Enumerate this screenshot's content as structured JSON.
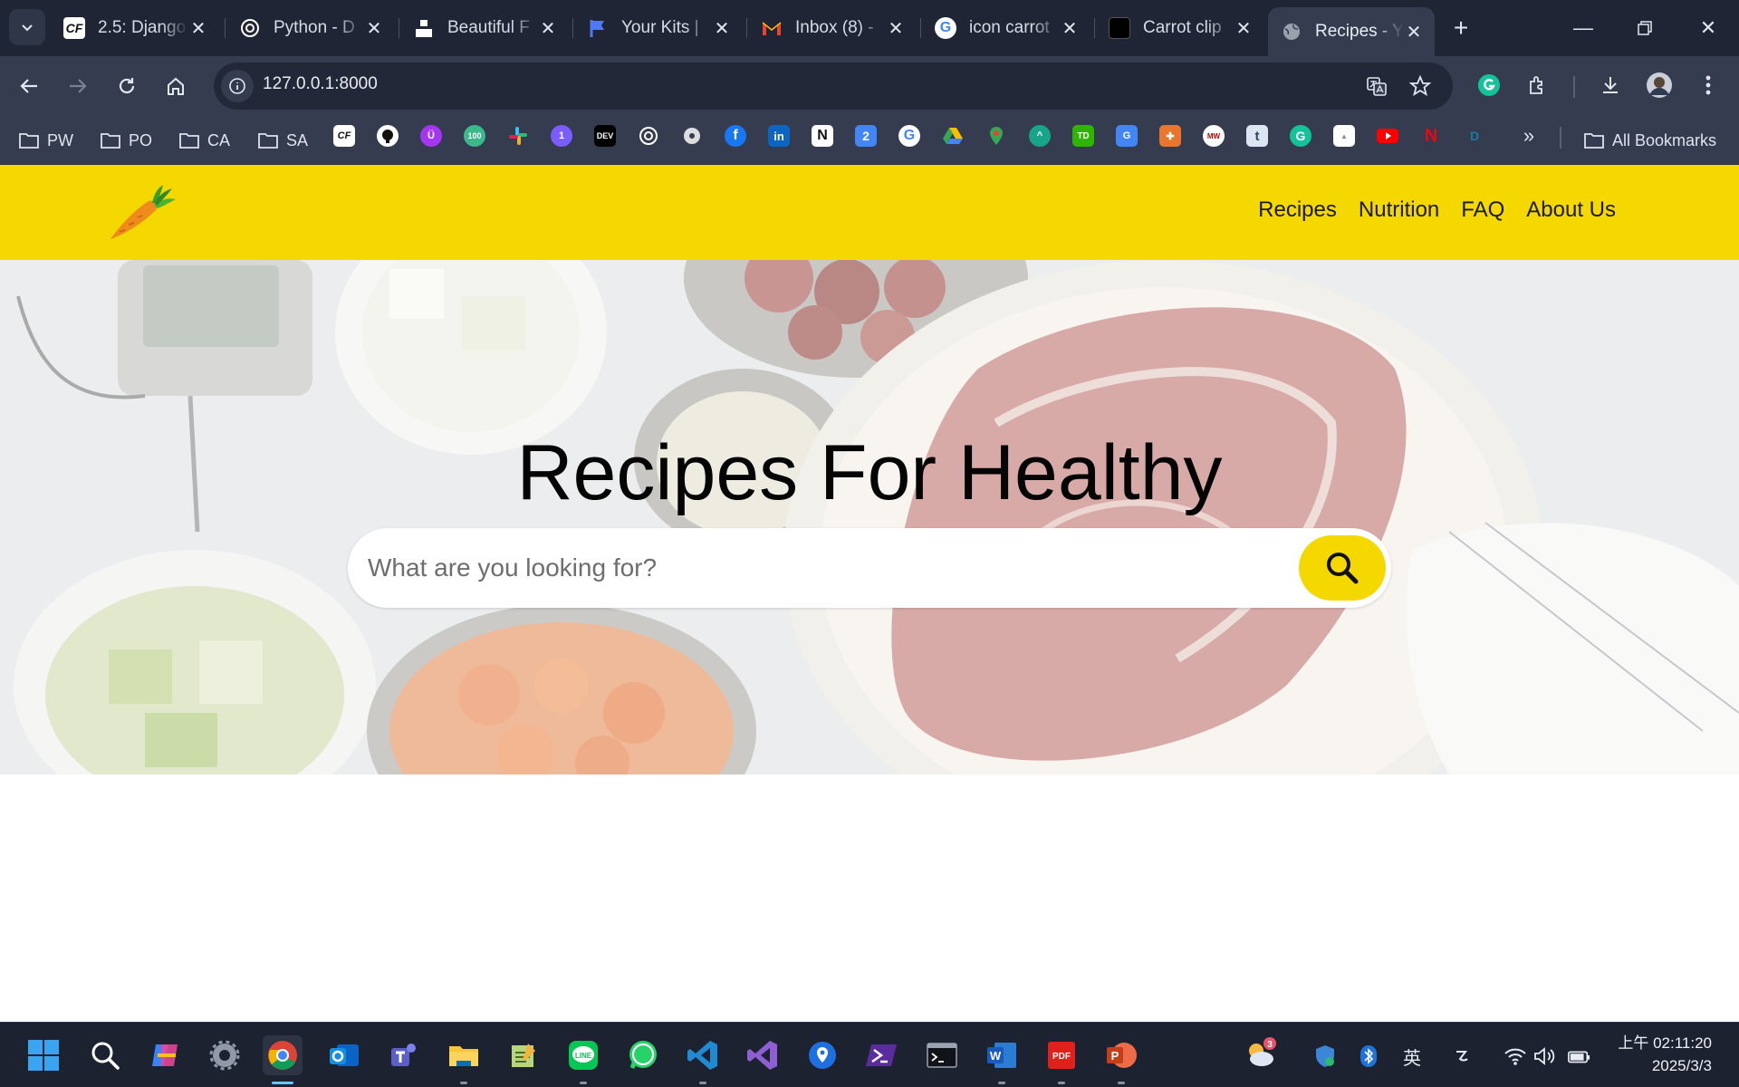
{
  "browser": {
    "tabs": [
      {
        "title": "2.5: Django",
        "icon": "cf-icon"
      },
      {
        "title": "Python - D",
        "icon": "openai-icon"
      },
      {
        "title": "Beautiful F",
        "icon": "unsplash-icon"
      },
      {
        "title": "Your Kits |",
        "icon": "flag-icon"
      },
      {
        "title": "Inbox (8) -",
        "icon": "gmail-icon"
      },
      {
        "title": "icon carrot",
        "icon": "google-icon"
      },
      {
        "title": "Carrot clip",
        "icon": "dark-square-icon"
      },
      {
        "title": "Recipes - Y",
        "icon": "globe-icon",
        "active": true
      }
    ],
    "url": "127.0.0.1:8000",
    "bookmark_folders": [
      "PW",
      "PO",
      "CA",
      "SA"
    ],
    "bookmark_icons": [
      "cf-icon",
      "github-icon",
      "udemy-icon",
      "100-icon",
      "slack-icon",
      "messenger-icon",
      "dev-icon",
      "openai-icon",
      "podcast-icon",
      "facebook-icon",
      "linkedin-icon",
      "notion-icon",
      "calendar-icon",
      "google-icon",
      "drive-icon",
      "maps-icon",
      "cloud-icon",
      "td-icon",
      "translate-icon",
      "crest-icon",
      "mw-icon",
      "tumblr-icon",
      "grammarly-icon",
      "doc-icon",
      "youtube-icon",
      "netflix-icon",
      "disney-icon"
    ],
    "all_bookmarks": "All Bookmarks"
  },
  "site": {
    "nav": [
      "Recipes",
      "Nutrition",
      "FAQ",
      "About Us"
    ],
    "hero_title": "Recipes For Healthy",
    "search_placeholder": "What are you looking for?",
    "accent": "#f5d800"
  },
  "taskbar": {
    "apps": [
      "windows-start-icon",
      "search-icon",
      "copilot-icon",
      "settings-icon",
      "chrome-icon",
      "outlook-icon",
      "teams-icon",
      "file-explorer-icon",
      "notepad-icon",
      "line-icon",
      "whatsapp-icon",
      "vscode-icon",
      "visual-studio-icon",
      "maps-pin-icon",
      "powershell-icon",
      "terminal-icon",
      "word-icon",
      "pdf-icon",
      "powerpoint-icon"
    ],
    "weather_badge": "3",
    "ime": "英",
    "time": "上午 02:11:20",
    "date": "2025/3/3"
  }
}
